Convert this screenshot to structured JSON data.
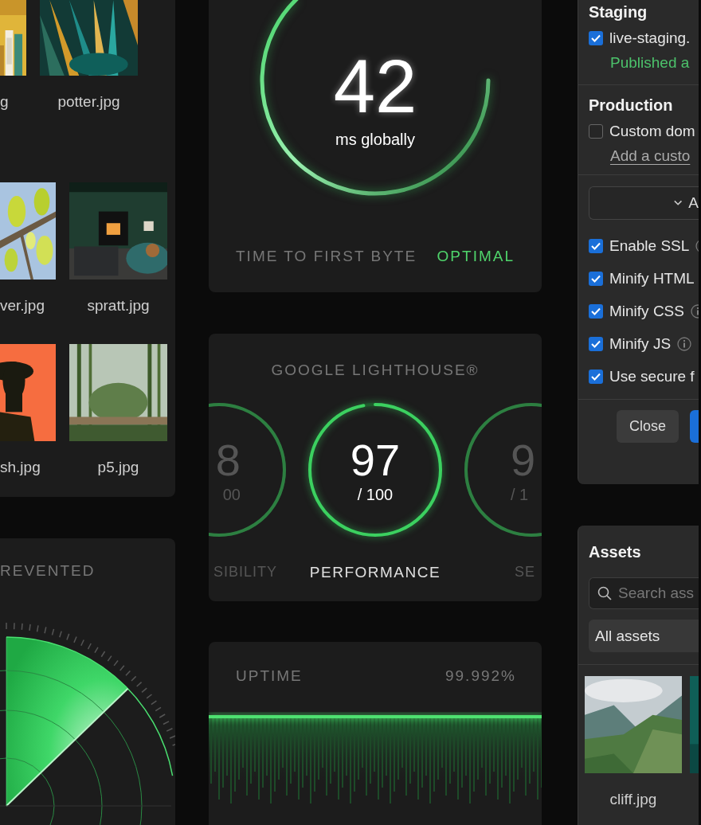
{
  "files_panel": {
    "files": [
      {
        "name": "g"
      },
      {
        "name": "potter.jpg"
      },
      {
        "name": "ver.jpg"
      },
      {
        "name": "spratt.jpg"
      },
      {
        "name": "sh.jpg"
      },
      {
        "name": "p5.jpg"
      }
    ]
  },
  "threats_panel": {
    "title": "REVENTED"
  },
  "ttfb_panel": {
    "value": "42",
    "unit": "ms globally",
    "label": "TIME TO FIRST BYTE",
    "status": "OPTIMAL"
  },
  "lighthouse_panel": {
    "title": "GOOGLE LIGHTHOUSE®",
    "gauges": [
      {
        "score": "8",
        "out_of": "00",
        "label": "SIBILITY",
        "selected": false
      },
      {
        "score": "97",
        "out_of": "/ 100",
        "label": "PERFORMANCE",
        "selected": true,
        "level": 0.97
      },
      {
        "score": "9",
        "out_of": "/ 1",
        "label": "SE",
        "selected": false
      }
    ]
  },
  "uptime_panel": {
    "label": "UPTIME",
    "value": "99.992%"
  },
  "publish_panel": {
    "staging": {
      "title": "Staging",
      "domain": {
        "label": "live-staging.",
        "checked": true
      },
      "status": "Published a"
    },
    "production": {
      "title": "Production",
      "domain": {
        "label": "Custom dom",
        "checked": false
      },
      "link": "Add a custo"
    },
    "dropdown": {
      "value": "A"
    },
    "options": [
      {
        "label": "Enable SSL",
        "checked": true,
        "info": true
      },
      {
        "label": "Minify HTML",
        "checked": true,
        "info": false
      },
      {
        "label": "Minify CSS",
        "checked": true,
        "info": true
      },
      {
        "label": "Minify JS",
        "checked": true,
        "info": true
      },
      {
        "label": "Use secure f",
        "checked": true,
        "info": false
      }
    ],
    "buttons": [
      "Close"
    ]
  },
  "assets_panel": {
    "title": "Assets",
    "search": {
      "placeholder": "Search ass"
    },
    "filter": {
      "value": "All assets"
    },
    "assets": [
      {
        "name": "cliff.jpg"
      }
    ]
  }
}
